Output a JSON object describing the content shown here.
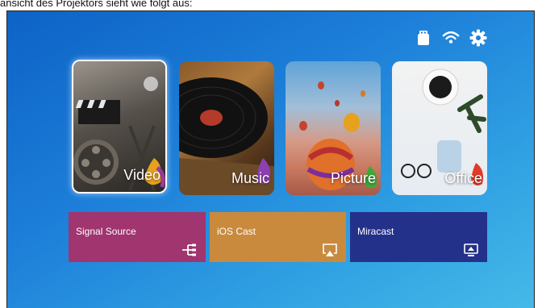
{
  "caption": "ansicht des Projektors sieht wie folgt aus:",
  "status_icons": [
    "usb-drive-icon",
    "wifi-icon",
    "gear-icon"
  ],
  "tiles": [
    {
      "label": "Video",
      "selected": true
    },
    {
      "label": "Music",
      "selected": false
    },
    {
      "label": "Picture",
      "selected": false
    },
    {
      "label": "Office",
      "selected": false
    }
  ],
  "bars": [
    {
      "label": "Signal Source",
      "color": "#a0356f",
      "icon": "input-source-icon"
    },
    {
      "label": "iOS Cast",
      "color": "#c98a3d",
      "icon": "airplay-icon"
    },
    {
      "label": "Miracast",
      "color": "#24318a",
      "icon": "screen-mirror-icon"
    }
  ],
  "colors": {
    "background_start": "#0d63c6",
    "background_end": "#45b9e8"
  }
}
